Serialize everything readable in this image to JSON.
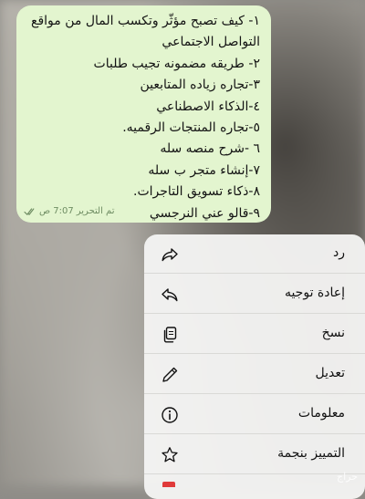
{
  "message": {
    "lines": [
      "١- كيف تصبح مؤثّر وتكسب المال من مواقع",
      "التواصل الاجتماعي",
      "٢- طريقه مضمونه تجيب طلبات",
      "٣-تجاره زياده المتابعين",
      "٤-الذكاء الاصطناعي",
      "٥-تجاره المنتجات الرقميه.",
      "٦ -شرح منصه سله",
      "٧-إنشاء متجر ب سله",
      "٨-ذكاء تسويق التاجرات.",
      "٩-قالو عني النرجسي"
    ],
    "edited_label": "تم التحرير",
    "time": "7:07 ص",
    "bubble_color": "#e3f5cf",
    "status_icon": "double-check-icon"
  },
  "context_menu": {
    "items": [
      {
        "label": "رد",
        "icon": "reply-icon"
      },
      {
        "label": "إعادة توجيه",
        "icon": "forward-icon"
      },
      {
        "label": "نسخ",
        "icon": "copy-icon"
      },
      {
        "label": "تعديل",
        "icon": "pencil-icon"
      },
      {
        "label": "معلومات",
        "icon": "info-icon"
      },
      {
        "label": "التمييز بنجمة",
        "icon": "star-icon"
      }
    ],
    "next_item_icon": "trash-icon",
    "danger_color": "#e03a3a"
  },
  "watermark": "حراج"
}
